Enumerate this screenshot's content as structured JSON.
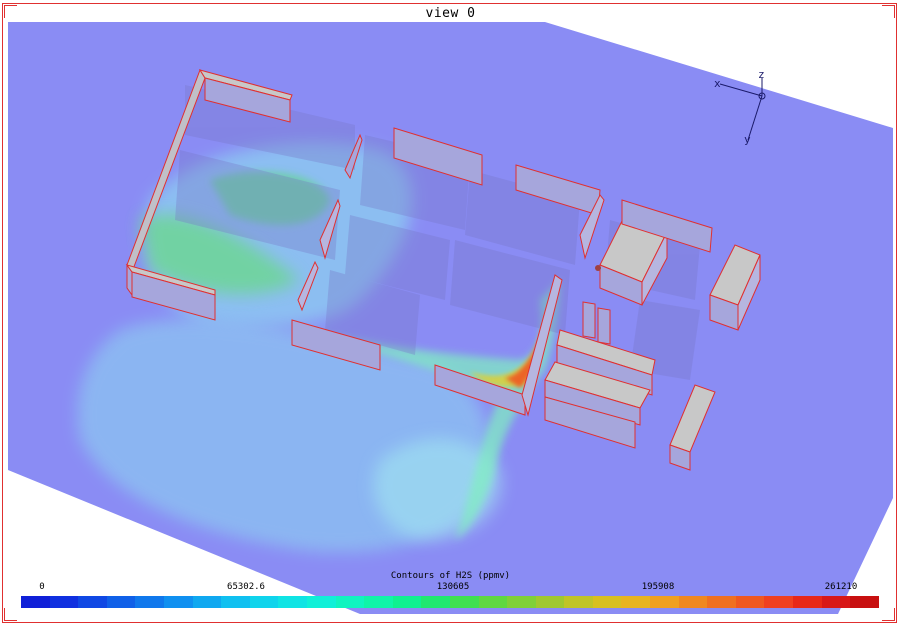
{
  "view": {
    "title": "view 0"
  },
  "axes": {
    "x_label": "x",
    "y_label": "y",
    "z_label": "z"
  },
  "legend": {
    "title": "Contours of H2S  (ppmv)",
    "ticks": [
      "0",
      "65302.6",
      "130605",
      "195908",
      "261210"
    ],
    "colors": [
      "#1020d8",
      "#1030e0",
      "#1048e4",
      "#1060e8",
      "#1078ec",
      "#1090f0",
      "#10a8f0",
      "#10c0f0",
      "#10d4ec",
      "#10e4e4",
      "#10f0d8",
      "#10f4c0",
      "#10f4a8",
      "#10f090",
      "#20e870",
      "#40e050",
      "#60d840",
      "#80d038",
      "#a0c830",
      "#c0c428",
      "#d8c020",
      "#e8b420",
      "#f0a020",
      "#f08820",
      "#f07020",
      "#f05820",
      "#f04020",
      "#e82818",
      "#d81818",
      "#c81010"
    ]
  },
  "colors": {
    "background_plane": "#8a8cf4",
    "building_face": "#a6a6dc",
    "building_roof": "#c8c8c8",
    "edge": "#e03030",
    "frame": "#e03030"
  }
}
